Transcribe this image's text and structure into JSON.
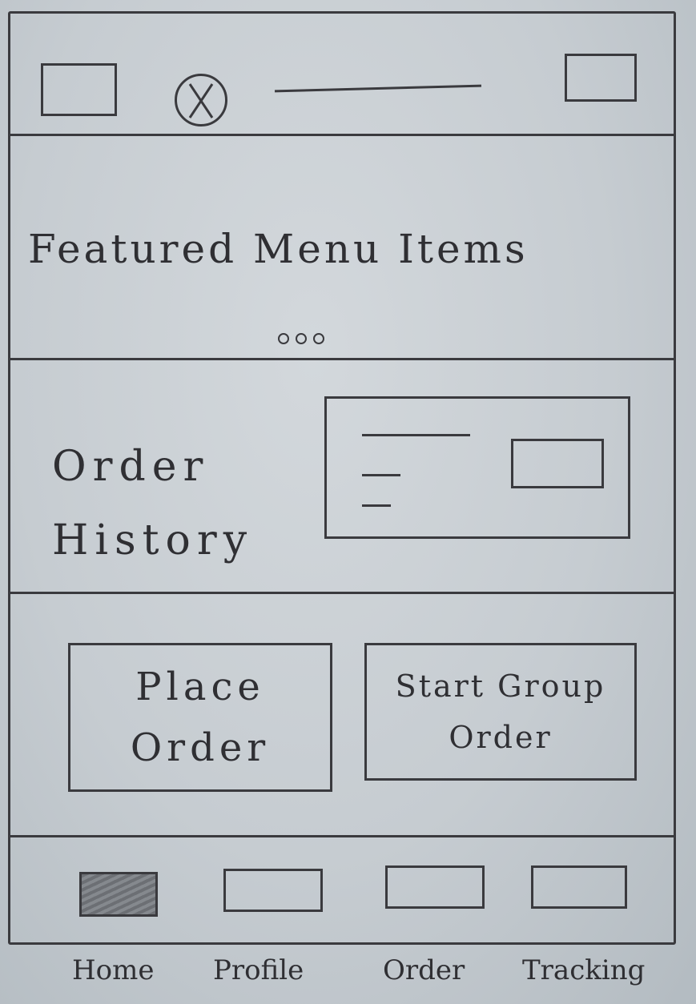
{
  "featured": {
    "title": "Featured Menu Items"
  },
  "order_history": {
    "label_line1": "Order",
    "label_line2": "History"
  },
  "actions": {
    "place_order_line1": "Place",
    "place_order_line2": "Order",
    "group_order_line1": "Start Group",
    "group_order_line2": "Order"
  },
  "bottom_nav": {
    "tabs": [
      {
        "label": "Home",
        "active": true
      },
      {
        "label": "Profile",
        "active": false
      },
      {
        "label": "Order",
        "active": false
      },
      {
        "label": "Tracking",
        "active": false
      }
    ]
  },
  "colors": {
    "ink": "#3a3a3e",
    "paper": "#c6ccd1"
  }
}
